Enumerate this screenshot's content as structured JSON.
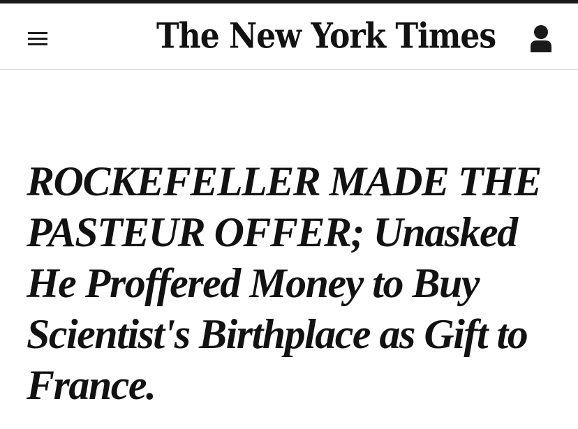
{
  "header": {
    "logo_text": "The New York Times",
    "menu_icon": "hamburger-menu-icon",
    "account_icon": "user-icon"
  },
  "article": {
    "headline": "ROCKEFELLER MADE THE PASTEUR OFFER; Unasked He Proffered Money to Buy Scientist's Birthplace as Gift to France."
  },
  "colors": {
    "text": "#121212",
    "top_bar": "#1a1a1a",
    "divider": "#dcdcdc",
    "background": "#ffffff"
  }
}
